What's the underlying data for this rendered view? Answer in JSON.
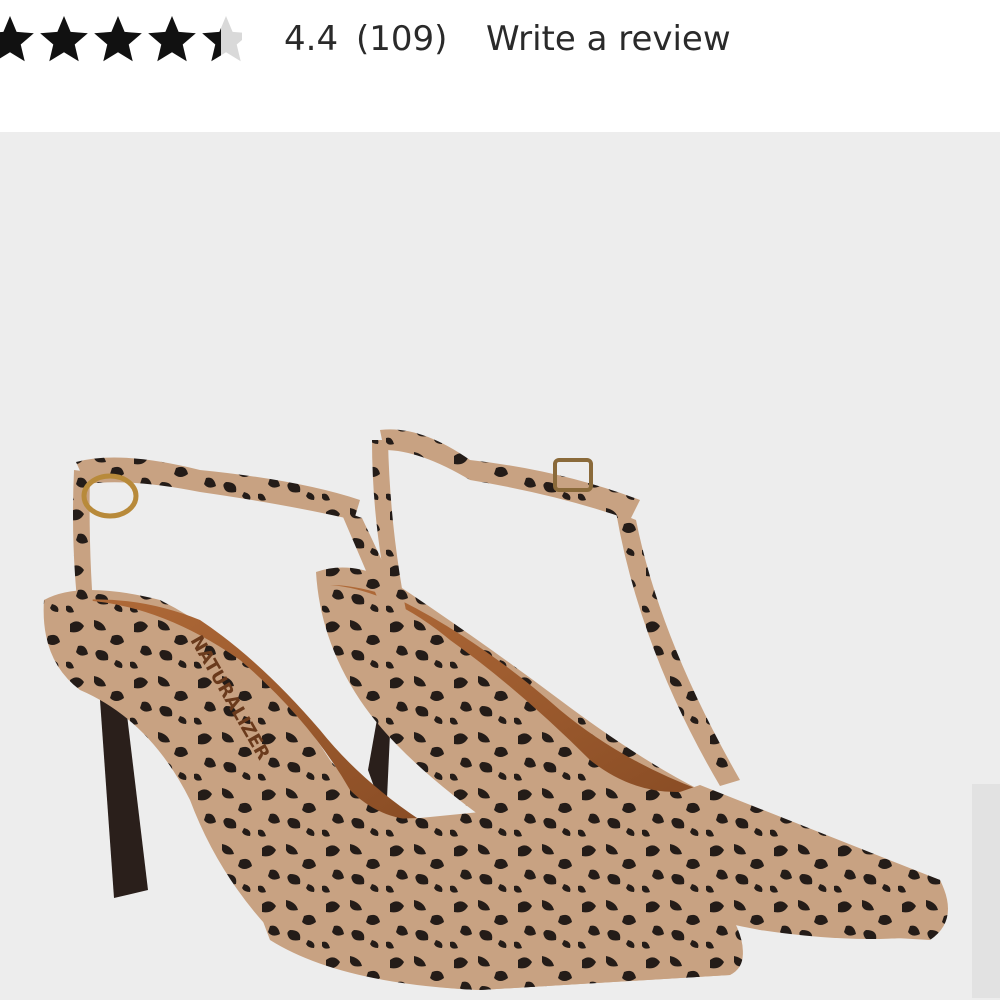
{
  "rating": {
    "value": "4.4",
    "count": "(109)",
    "write_review_label": "Write a review",
    "stars_value": 4.4,
    "stars_max": 5,
    "star_fill_color": "#111111",
    "star_empty_color": "#d9d9d9"
  },
  "product_image": {
    "brand_imprint": "NATURALIZER",
    "background_color": "#ededed",
    "print_base_color": "#c8a282",
    "print_spot_color": "#241c18",
    "lining_color": "#9c5a2e",
    "heel_color": "#2a1f1b"
  },
  "icons": {
    "stars": "star-icon",
    "next": "chevron-right-icon"
  }
}
